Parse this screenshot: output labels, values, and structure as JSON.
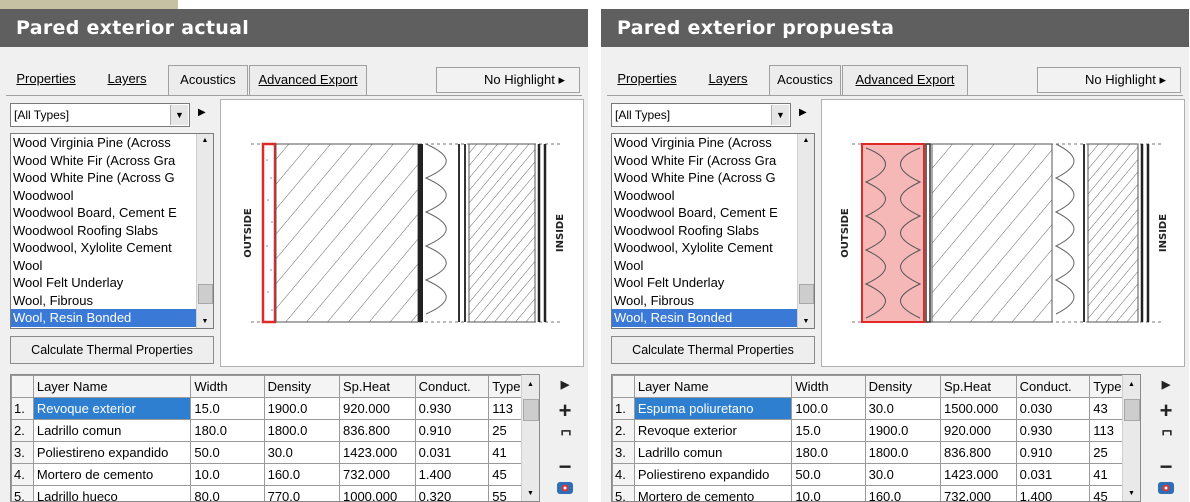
{
  "panels": [
    {
      "heading": "Pared exterior actual",
      "tabs": {
        "properties": "Properties",
        "layers": "Layers",
        "acoustics": "Acoustics",
        "advanced_export": "Advanced Export",
        "highlight": "No Highlight ▸"
      },
      "type_filter": "[All Types]",
      "materials": [
        "Wood Virginia Pine (Across",
        "Wood White Fir (Across Gra",
        "Wood White Pine (Across G",
        "Woodwool",
        "Woodwool Board, Cement E",
        "Woodwool Roofing Slabs",
        "Woodwool, Xylolite Cement",
        "Wool",
        "Wool Felt Underlay",
        "Wool, Fibrous",
        "Wool, Resin Bonded"
      ],
      "selected_material": "Wool, Resin Bonded",
      "calc_button": "Calculate Thermal Properties",
      "diagram": {
        "outside_label": "OUTSIDE",
        "inside_label": "INSIDE",
        "highlighted_layer": "red render/plaster layer"
      },
      "columns": [
        "Layer Name",
        "Width",
        "Density",
        "Sp.Heat",
        "Conduct.",
        "Type"
      ],
      "rows": [
        {
          "num": "1.",
          "name": "Revoque exterior",
          "width": "15.0",
          "density": "1900.0",
          "spheat": "920.000",
          "conduct": "0.930",
          "type": "113"
        },
        {
          "num": "2.",
          "name": "Ladrillo comun",
          "width": "180.0",
          "density": "1800.0",
          "spheat": "836.800",
          "conduct": "0.910",
          "type": "25"
        },
        {
          "num": "3.",
          "name": "Poliestireno expandido",
          "width": "50.0",
          "density": "30.0",
          "spheat": "1423.000",
          "conduct": "0.031",
          "type": "41"
        },
        {
          "num": "4.",
          "name": "Mortero de cemento",
          "width": "10.0",
          "density": "160.0",
          "spheat": "732.000",
          "conduct": "1.400",
          "type": "45"
        },
        {
          "num": "5.",
          "name": "Ladrillo hueco",
          "width": "80.0",
          "density": "770.0",
          "spheat": "1000.000",
          "conduct": "0.320",
          "type": "55"
        }
      ]
    },
    {
      "heading": "Pared exterior propuesta",
      "tabs": {
        "properties": "Properties",
        "layers": "Layers",
        "acoustics": "Acoustics",
        "advanced_export": "Advanced Export",
        "highlight": "No Highlight ▸"
      },
      "type_filter": "[All Types]",
      "materials": [
        "Wood Virginia Pine (Across",
        "Wood White Fir (Across Gra",
        "Wood White Pine (Across G",
        "Woodwool",
        "Woodwool Board, Cement E",
        "Woodwool Roofing Slabs",
        "Woodwool, Xylolite Cement",
        "Wool",
        "Wool Felt Underlay",
        "Wool, Fibrous",
        "Wool, Resin Bonded"
      ],
      "selected_material": "Wool, Resin Bonded",
      "calc_button": "Calculate Thermal Properties",
      "diagram": {
        "outside_label": "OUTSIDE",
        "inside_label": "INSIDE",
        "highlighted_layer": "pink foam insulation layer"
      },
      "columns": [
        "Layer Name",
        "Width",
        "Density",
        "Sp.Heat",
        "Conduct.",
        "Type"
      ],
      "rows": [
        {
          "num": "1.",
          "name": "Espuma poliuretano",
          "width": "100.0",
          "density": "30.0",
          "spheat": "1500.000",
          "conduct": "0.030",
          "type": "43"
        },
        {
          "num": "2.",
          "name": "Revoque exterior",
          "width": "15.0",
          "density": "1900.0",
          "spheat": "920.000",
          "conduct": "0.930",
          "type": "113"
        },
        {
          "num": "3.",
          "name": "Ladrillo comun",
          "width": "180.0",
          "density": "1800.0",
          "spheat": "836.800",
          "conduct": "0.910",
          "type": "25"
        },
        {
          "num": "4.",
          "name": "Poliestireno expandido",
          "width": "50.0",
          "density": "30.0",
          "spheat": "1423.000",
          "conduct": "0.031",
          "type": "41"
        },
        {
          "num": "5.",
          "name": "Mortero de cemento",
          "width": "10.0",
          "density": "160.0",
          "spheat": "732.000",
          "conduct": "1.400",
          "type": "45"
        }
      ]
    }
  ],
  "icons": {
    "tab_right_arrow": "▸",
    "combo_dropdown": "▼",
    "add": "+",
    "expand": "expand-icon",
    "remove": "−",
    "view": "view-icon"
  },
  "colors": {
    "heading_bg": "#5f5f5f",
    "selection": "#2f7fd1",
    "render_layer": "#e02a2a",
    "foam_layer": "#f6b7b7"
  }
}
